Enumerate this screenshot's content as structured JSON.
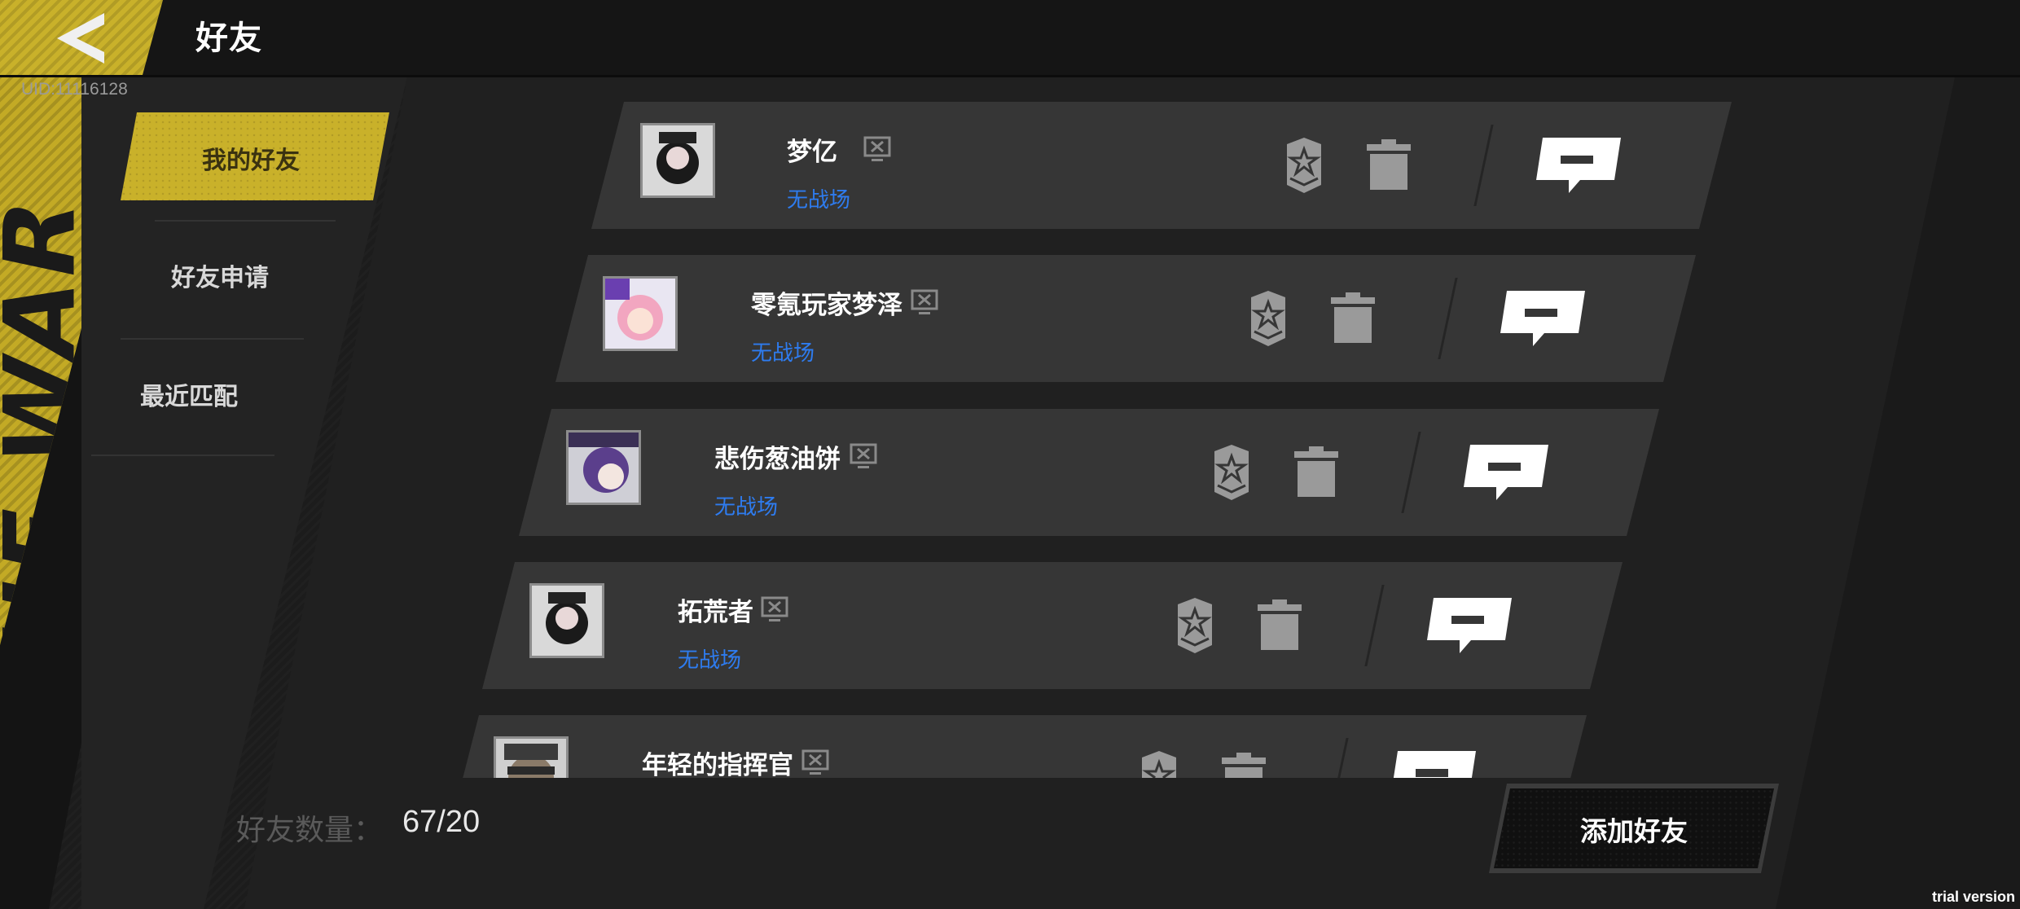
{
  "header": {
    "title": "好友",
    "back_icon": "back-arrow-icon"
  },
  "uid": "UID:11116128",
  "side_decoration": "THE WAR",
  "nav": {
    "items": [
      {
        "label": "我的好友",
        "active": true
      },
      {
        "label": "好友申请",
        "active": false
      },
      {
        "label": "最近匹配",
        "active": false
      }
    ]
  },
  "friends": [
    {
      "name": "梦亿",
      "status": "无战场",
      "platform_icon": "pc-monitor-icon"
    },
    {
      "name": "零氪玩家梦泽",
      "status": "无战场",
      "platform_icon": "pc-monitor-icon"
    },
    {
      "name": "悲伤葱油饼",
      "status": "无战场",
      "platform_icon": "pc-monitor-icon"
    },
    {
      "name": "拓荒者",
      "status": "无战场",
      "platform_icon": "pc-monitor-icon"
    },
    {
      "name": "年轻的指挥官",
      "status": "",
      "platform_icon": "pc-monitor-icon"
    }
  ],
  "footer": {
    "count_label": "好友数量：",
    "count_value": "67/20",
    "add_button": "添加好友"
  },
  "watermark": "trial version",
  "colors": {
    "accent": "#c9b12a",
    "status": "#2e7cf0",
    "row": "#363636"
  }
}
